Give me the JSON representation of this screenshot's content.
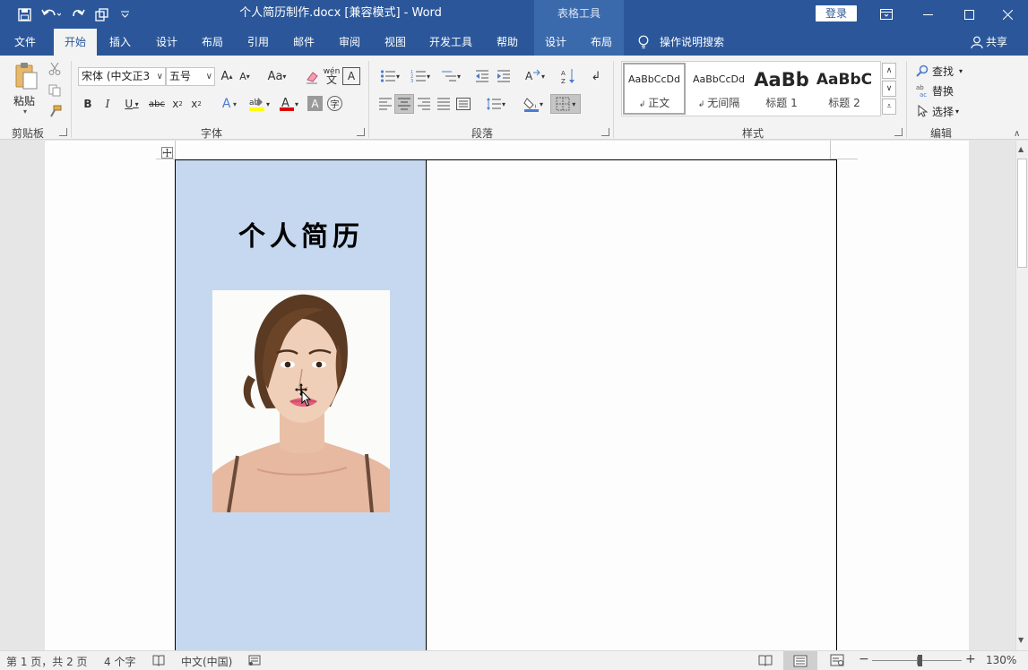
{
  "window": {
    "title": "个人简历制作.docx [兼容模式]  -  Word",
    "context_tool": "表格工具",
    "login": "登录"
  },
  "tabs": [
    "文件",
    "开始",
    "插入",
    "设计",
    "布局",
    "引用",
    "邮件",
    "审阅",
    "视图",
    "开发工具",
    "帮助",
    "设计",
    "布局"
  ],
  "tell_me": "操作说明搜索",
  "share": "共享",
  "ribbon": {
    "clipboard": {
      "paste": "粘贴",
      "label": "剪贴板"
    },
    "font": {
      "name": "宋体 (中文正3",
      "size": "五号",
      "label": "字体"
    },
    "paragraph": {
      "label": "段落"
    },
    "styles": {
      "label": "样式",
      "items": [
        {
          "sample": "AaBbCcDd",
          "name": "正文"
        },
        {
          "sample": "AaBbCcDd",
          "name": "无间隔"
        },
        {
          "sample": "AaBb",
          "name": "标题 1"
        },
        {
          "sample": "AaBbC",
          "name": "标题 2"
        }
      ]
    },
    "editing": {
      "find": "查找",
      "replace": "替换",
      "select": "选择",
      "label": "编辑"
    }
  },
  "document": {
    "resume_title": "个人简历",
    "photo_alt": "证件照"
  },
  "status": {
    "page": "第 1 页，共 2 页",
    "words": "4 个字",
    "language": "中文(中国)",
    "zoom": "130%"
  },
  "colors": {
    "brand": "#2b579a",
    "cell_fill": "#c6d8ef"
  }
}
